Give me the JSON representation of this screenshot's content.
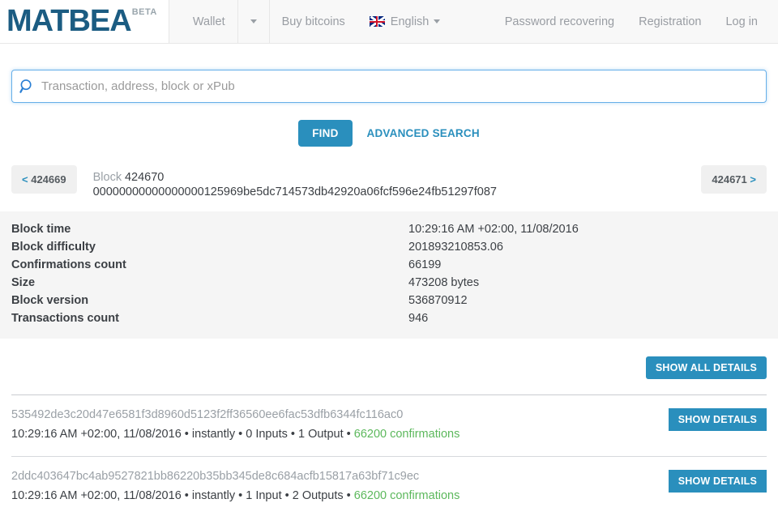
{
  "navbar": {
    "brand": "MATBEA",
    "brand_badge": "BETA",
    "wallet": "Wallet",
    "buy_bitcoins": "Buy bitcoins",
    "language": "English",
    "language_flag_icon": "uk-flag-icon",
    "password_recovering": "Password recovering",
    "registration": "Registration",
    "login": "Log in"
  },
  "search": {
    "icon": "search-icon",
    "value": "",
    "placeholder": "Transaction, address, block or xPub",
    "find_label": "FIND",
    "advanced_label": "ADVANCED SEARCH"
  },
  "block_nav": {
    "prev_label": "< 424669",
    "prev_chevron": "<",
    "prev_number": "424669",
    "next_label": "424671 >",
    "next_chevron": ">",
    "next_number": "424671",
    "block_word": "Block",
    "block_number": "424670",
    "block_hash": "00000000000000000125969be5dc714573db42920a06fcf596e24fb51297f087"
  },
  "details": {
    "rows": [
      {
        "key": "Block time",
        "value": "10:29:16 AM +02:00, 11/08/2016"
      },
      {
        "key": "Block difficulty",
        "value": "201893210853.06"
      },
      {
        "key": "Confirmations count",
        "value": "66199"
      },
      {
        "key": "Size",
        "value": "473208 bytes"
      },
      {
        "key": "Block version",
        "value": "536870912"
      },
      {
        "key": "Transactions count",
        "value": "946"
      }
    ],
    "show_all_label": "SHOW ALL DETAILS"
  },
  "transactions": {
    "show_details_label": "SHOW DETAILS",
    "items": [
      {
        "hash": "535492de3c20d47e6581f3d8960d5123f2ff36560ee6fac53dfb6344fc116ac0",
        "time": "10:29:16 AM +02:00, 11/08/2016",
        "speed": "instantly",
        "inputs": "0 Inputs",
        "outputs": "1 Output",
        "confirmations": "66200 confirmations",
        "sep": " • "
      },
      {
        "hash": "2ddc403647bc4ab9527821bb86220b35bb345de8c684acfb15817a63bf71c9ec",
        "time": "10:29:16 AM +02:00, 11/08/2016",
        "speed": "instantly",
        "inputs": "1 Input",
        "outputs": "2 Outputs",
        "confirmations": "66200 confirmations",
        "sep": " • "
      }
    ]
  },
  "colors": {
    "brand": "#1b5c82",
    "accent": "#2a8fbd",
    "confirmations": "#5cb85c",
    "panel_bg": "#f5f5f5"
  }
}
